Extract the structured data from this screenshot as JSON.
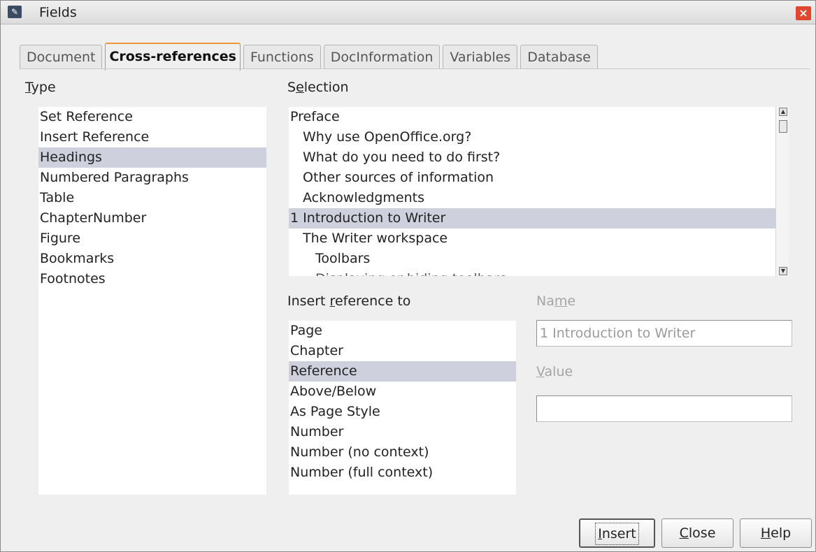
{
  "window": {
    "title": "Fields",
    "app_icon": "openoffice-writer-icon",
    "close_glyph": "×"
  },
  "tabs": [
    {
      "label": "Document",
      "active": false
    },
    {
      "label": "Cross-references",
      "active": true
    },
    {
      "label": "Functions",
      "active": false
    },
    {
      "label": "DocInformation",
      "active": false
    },
    {
      "label": "Variables",
      "active": false
    },
    {
      "label": "Database",
      "active": false
    }
  ],
  "type": {
    "label_first": "T",
    "label_rest": "ype",
    "items": [
      "Set Reference",
      "Insert Reference",
      "Headings",
      "Numbered Paragraphs",
      "Table",
      "ChapterNumber",
      "Figure",
      "Bookmarks",
      "Footnotes"
    ],
    "selected": "Headings"
  },
  "selection": {
    "label_pre": "S",
    "label_u": "e",
    "label_post": "lection",
    "items": [
      "Preface",
      "Why use OpenOffice.org?",
      "What do you need to do first?",
      "Other sources of information",
      "Acknowledgments",
      "1 Introduction to Writer",
      "The Writer workspace",
      "Toolbars",
      "Displaying or hiding toolbars"
    ],
    "selected": "1 Introduction to Writer"
  },
  "insert_reference": {
    "label_pre": "Insert ",
    "label_u": "r",
    "label_post": "eference to",
    "items": [
      "Page",
      "Chapter",
      "Reference",
      "Above/Below",
      "As Page Style",
      "Number",
      "Number (no context)",
      "Number (full context)"
    ],
    "selected": "Reference"
  },
  "name": {
    "label_pre": "Na",
    "label_u": "m",
    "label_post": "e",
    "value": "1 Introduction to Writer"
  },
  "value": {
    "label_u": "V",
    "label_post": "alue",
    "value": ""
  },
  "buttons": {
    "insert_u": "I",
    "insert_rest": "nsert",
    "close_u": "C",
    "close_rest": "lose",
    "help_u": "H",
    "help_rest": "elp"
  }
}
